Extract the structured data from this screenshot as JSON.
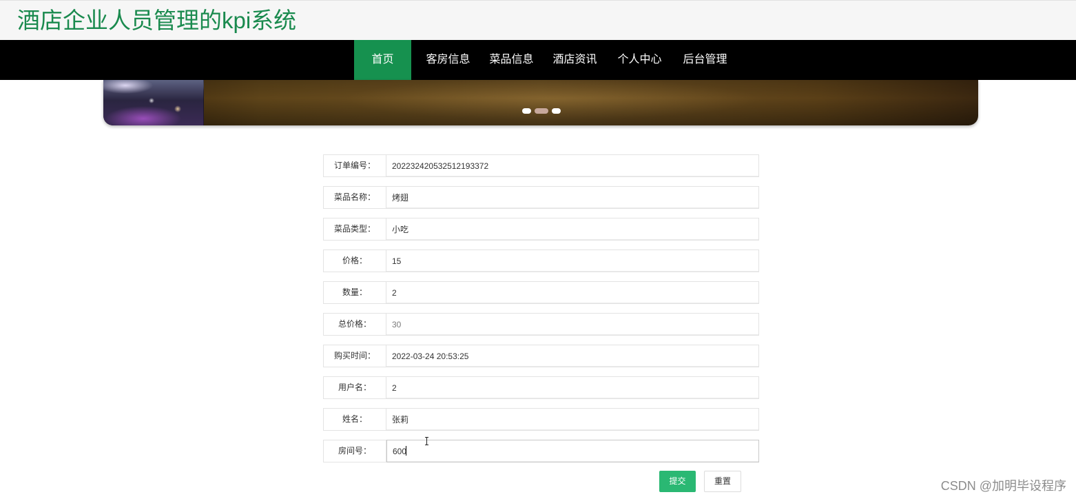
{
  "app": {
    "title": "酒店企业人员管理的kpi系统"
  },
  "nav": {
    "items": [
      {
        "label": "首页",
        "active": true
      },
      {
        "label": "客房信息",
        "active": false
      },
      {
        "label": "菜品信息",
        "active": false
      },
      {
        "label": "酒店资讯",
        "active": false
      },
      {
        "label": "个人中心",
        "active": false
      },
      {
        "label": "后台管理",
        "active": false
      }
    ]
  },
  "carousel": {
    "slides": 3,
    "active_index": 1
  },
  "form": {
    "fields": [
      {
        "label": "订单编号：",
        "value": "202232420532512193372"
      },
      {
        "label": "菜品名称：",
        "value": "烤翅"
      },
      {
        "label": "菜品类型：",
        "value": "小吃"
      },
      {
        "label": "价格：",
        "value": "15"
      },
      {
        "label": "数量：",
        "value": "2"
      },
      {
        "label": "总价格：",
        "value": "30",
        "readonly": true
      },
      {
        "label": "购买时间：",
        "value": "2022-03-24 20:53:25"
      },
      {
        "label": "用户名：",
        "value": "2"
      },
      {
        "label": "姓名：",
        "value": "张莉"
      },
      {
        "label": "房间号：",
        "value": "600",
        "focused": true
      }
    ],
    "submit_label": "提交",
    "reset_label": "重置"
  },
  "watermark": "CSDN @加明毕设程序",
  "colors": {
    "brand_green": "#1a8a4e",
    "nav_background": "#000000",
    "nav_active": "#16914f",
    "submit_button": "#2ab873"
  }
}
